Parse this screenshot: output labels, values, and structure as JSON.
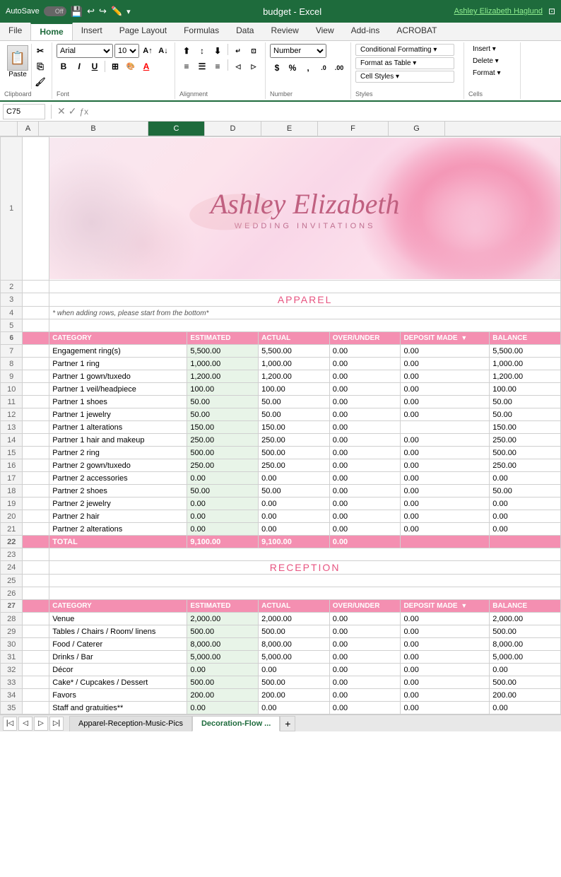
{
  "titleBar": {
    "autosave": "AutoSave",
    "autosave_state": "Off",
    "filename": "budget - Excel",
    "username": "Ashley Elizabeth Haglund"
  },
  "ribbonTabs": [
    "File",
    "Home",
    "Insert",
    "Page Layout",
    "Formulas",
    "Data",
    "Review",
    "View",
    "Add-ins",
    "ACROBAT"
  ],
  "activeTab": "Home",
  "ribbon": {
    "paste_label": "Paste",
    "clipboard_label": "Clipboard",
    "font_label": "Font",
    "alignment_label": "Alignment",
    "number_label": "Number",
    "styles_label": "Styles",
    "cells_label": "Cells",
    "font_name": "Arial",
    "font_size": "10",
    "number_format": "Number",
    "conditional_formatting": "Conditional Formatting",
    "format_as_table": "Format as Table",
    "cell_styles": "Cell Styles",
    "insert_label": "Insert",
    "delete_label": "Delete",
    "format_label": "Format"
  },
  "formulaBar": {
    "cell_ref": "C75",
    "formula": ""
  },
  "columns": {
    "headers": [
      "A",
      "B",
      "C",
      "D",
      "E",
      "F",
      "G"
    ],
    "widths": [
      30,
      155,
      80,
      80,
      80,
      100,
      80
    ]
  },
  "header": {
    "script_text": "Ashley Elizabeth",
    "subtitle": "WEDDING INVITATIONS"
  },
  "apparel": {
    "section_title": "APPAREL",
    "note": "* when adding rows, please start from the bottom*",
    "col_headers": [
      "CATEGORY",
      "ESTIMATED",
      "ACTUAL",
      "OVER/UNDER",
      "DEPOSIT MADE",
      "BALANCE"
    ],
    "rows": [
      [
        "Engagement ring(s)",
        "5,500.00",
        "5,500.00",
        "0.00",
        "0.00",
        "5,500.00"
      ],
      [
        "Partner 1 ring",
        "1,000.00",
        "1,000.00",
        "0.00",
        "0.00",
        "1,000.00"
      ],
      [
        "Partner 1 gown/tuxedo",
        "1,200.00",
        "1,200.00",
        "0.00",
        "0.00",
        "1,200.00"
      ],
      [
        "Partner 1 veil/headpiece",
        "100.00",
        "100.00",
        "0.00",
        "0.00",
        "100.00"
      ],
      [
        "Partner 1 shoes",
        "50.00",
        "50.00",
        "0.00",
        "0.00",
        "50.00"
      ],
      [
        "Partner 1 jewelry",
        "50.00",
        "50.00",
        "0.00",
        "0.00",
        "50.00"
      ],
      [
        "Partner 1 alterations",
        "150.00",
        "150.00",
        "0.00",
        "",
        "150.00"
      ],
      [
        "Partner 1 hair and makeup",
        "250.00",
        "250.00",
        "0.00",
        "0.00",
        "250.00"
      ],
      [
        "Partner 2 ring",
        "500.00",
        "500.00",
        "0.00",
        "0.00",
        "500.00"
      ],
      [
        "Partner 2 gown/tuxedo",
        "250.00",
        "250.00",
        "0.00",
        "0.00",
        "250.00"
      ],
      [
        "Partner 2 accessories",
        "0.00",
        "0.00",
        "0.00",
        "0.00",
        "0.00"
      ],
      [
        "Partner 2 shoes",
        "50.00",
        "50.00",
        "0.00",
        "0.00",
        "50.00"
      ],
      [
        "Partner 2 jewelry",
        "0.00",
        "0.00",
        "0.00",
        "0.00",
        "0.00"
      ],
      [
        "Partner 2 hair",
        "0.00",
        "0.00",
        "0.00",
        "0.00",
        "0.00"
      ],
      [
        "Partner 2 alterations",
        "0.00",
        "0.00",
        "0.00",
        "0.00",
        "0.00"
      ]
    ],
    "total_row": [
      "TOTAL",
      "9,100.00",
      "9,100.00",
      "0.00",
      "",
      ""
    ],
    "row_numbers_start": 7
  },
  "reception": {
    "section_title": "RECEPTION",
    "col_headers": [
      "CATEGORY",
      "ESTIMATED",
      "ACTUAL",
      "OVER/UNDER",
      "DEPOSIT MADE",
      "BALANCE"
    ],
    "rows": [
      [
        "Venue",
        "2,000.00",
        "2,000.00",
        "0.00",
        "0.00",
        "2,000.00"
      ],
      [
        "Tables / Chairs / Room/ linens",
        "500.00",
        "500.00",
        "0.00",
        "0.00",
        "500.00"
      ],
      [
        "Food / Caterer",
        "8,000.00",
        "8,000.00",
        "0.00",
        "0.00",
        "8,000.00"
      ],
      [
        "Drinks / Bar",
        "5,000.00",
        "5,000.00",
        "0.00",
        "0.00",
        "5,000.00"
      ],
      [
        "Décor",
        "0.00",
        "0.00",
        "0.00",
        "0.00",
        "0.00"
      ],
      [
        "Cake* / Cupcakes / Dessert",
        "500.00",
        "500.00",
        "0.00",
        "0.00",
        "500.00"
      ],
      [
        "Favors",
        "200.00",
        "200.00",
        "0.00",
        "0.00",
        "200.00"
      ],
      [
        "Staff and gratuities**",
        "0.00",
        "0.00",
        "0.00",
        "0.00",
        "0.00"
      ]
    ],
    "row_numbers_start": 28
  },
  "sheetTabs": [
    {
      "label": "Apparel-Reception-Music-Pics",
      "active": false
    },
    {
      "label": "Decoration-Flow ...",
      "active": true
    }
  ],
  "statusBar": {
    "add_sheet": "+"
  }
}
